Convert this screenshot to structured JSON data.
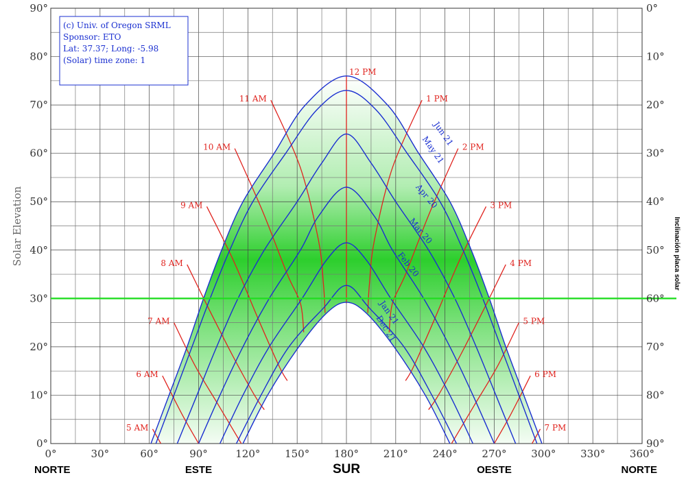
{
  "chart_data": {
    "type": "line",
    "ylabel": "Solar Elevation",
    "y2label": "Inclinación placa solar",
    "xlim": [
      0,
      360
    ],
    "ylim": [
      0,
      90
    ],
    "x_ticks": [
      "0°",
      "30°",
      "60°",
      "90°",
      "120°",
      "150°",
      "180°",
      "210°",
      "240°",
      "270°",
      "300°",
      "330°",
      "360°"
    ],
    "y_ticks": [
      "0°",
      "10°",
      "20°",
      "30°",
      "40°",
      "50°",
      "60°",
      "70°",
      "80°",
      "90°"
    ],
    "y2_ticks": [
      "90°",
      "80°",
      "70°",
      "60°",
      "50°",
      "40°",
      "30°",
      "20°",
      "10°",
      "0°"
    ],
    "directions": [
      {
        "label": "NORTE",
        "x": 0
      },
      {
        "label": "ESTE",
        "x": 90
      },
      {
        "label": "SUR",
        "x": 180
      },
      {
        "label": "OESTE",
        "x": 270
      },
      {
        "label": "NORTE",
        "x": 360
      }
    ],
    "info_box": [
      "(c) Univ. of Oregon SRML",
      "Sponsor: ETO",
      "Lat: 37.37; Long: -5.98",
      "(Solar) time zone: 1"
    ],
    "reference_line": {
      "elevation": 30,
      "color": "#22dd22"
    },
    "highlight_band": {
      "min_elevation": 0,
      "max_elevation": 60,
      "color": "#22cc22"
    },
    "date_curves": [
      {
        "label": "Jun 21",
        "points": [
          [
            61,
            0
          ],
          [
            72,
            10
          ],
          [
            83,
            20
          ],
          [
            93,
            30
          ],
          [
            104,
            40
          ],
          [
            117,
            50
          ],
          [
            136,
            60
          ],
          [
            155,
            70
          ],
          [
            180,
            76
          ],
          [
            205,
            70
          ],
          [
            224,
            60
          ],
          [
            243,
            50
          ],
          [
            256,
            40
          ],
          [
            267,
            30
          ],
          [
            277,
            20
          ],
          [
            288,
            10
          ],
          [
            299,
            0
          ]
        ]
      },
      {
        "label": "May 21",
        "points": [
          [
            64,
            0
          ],
          [
            75,
            10
          ],
          [
            86,
            20
          ],
          [
            97,
            30
          ],
          [
            109,
            40
          ],
          [
            123,
            50
          ],
          [
            143,
            60
          ],
          [
            162,
            69
          ],
          [
            180,
            73
          ],
          [
            198,
            69
          ],
          [
            217,
            60
          ],
          [
            237,
            50
          ],
          [
            251,
            40
          ],
          [
            263,
            30
          ],
          [
            274,
            20
          ],
          [
            285,
            10
          ],
          [
            296,
            0
          ]
        ]
      },
      {
        "label": "Apr 20",
        "points": [
          [
            77,
            0
          ],
          [
            89,
            10
          ],
          [
            101,
            20
          ],
          [
            114,
            30
          ],
          [
            130,
            40
          ],
          [
            150,
            50
          ],
          [
            165,
            58
          ],
          [
            180,
            64
          ],
          [
            195,
            58
          ],
          [
            210,
            50
          ],
          [
            230,
            40
          ],
          [
            246,
            30
          ],
          [
            259,
            20
          ],
          [
            271,
            10
          ],
          [
            283,
            0
          ]
        ]
      },
      {
        "label": "Mar 20",
        "points": [
          [
            90,
            0
          ],
          [
            103,
            10
          ],
          [
            117,
            20
          ],
          [
            133,
            30
          ],
          [
            152,
            40
          ],
          [
            163,
            47
          ],
          [
            180,
            53
          ],
          [
            197,
            47
          ],
          [
            208,
            40
          ],
          [
            227,
            30
          ],
          [
            243,
            20
          ],
          [
            257,
            10
          ],
          [
            270,
            0
          ]
        ]
      },
      {
        "label": "Feb 20",
        "points": [
          [
            103,
            0
          ],
          [
            117,
            10
          ],
          [
            133,
            20
          ],
          [
            153,
            30
          ],
          [
            168,
            38
          ],
          [
            180,
            41.5
          ],
          [
            192,
            38
          ],
          [
            207,
            30
          ],
          [
            227,
            20
          ],
          [
            243,
            10
          ],
          [
            257,
            0
          ]
        ]
      },
      {
        "label": "Jan 21",
        "points": [
          [
            113,
            0
          ],
          [
            128,
            10
          ],
          [
            145,
            20
          ],
          [
            166,
            28
          ],
          [
            180,
            32.7
          ],
          [
            194,
            28
          ],
          [
            215,
            20
          ],
          [
            232,
            10
          ],
          [
            247,
            0
          ]
        ]
      },
      {
        "label": "Dec 21",
        "points": [
          [
            117,
            0
          ],
          [
            132,
            10
          ],
          [
            151,
            20
          ],
          [
            168,
            27
          ],
          [
            180,
            29.2
          ],
          [
            192,
            27
          ],
          [
            209,
            20
          ],
          [
            228,
            10
          ],
          [
            243,
            0
          ]
        ]
      }
    ],
    "hour_curves": [
      {
        "label": "5 AM",
        "points": [
          [
            62,
            3
          ],
          [
            67,
            0
          ]
        ]
      },
      {
        "label": "6 AM",
        "points": [
          [
            68,
            14
          ],
          [
            80,
            6
          ],
          [
            90,
            0
          ]
        ]
      },
      {
        "label": "7 AM",
        "points": [
          [
            75,
            25
          ],
          [
            88,
            16
          ],
          [
            102,
            8
          ],
          [
            116,
            0
          ]
        ]
      },
      {
        "label": "8 AM",
        "points": [
          [
            83,
            37
          ],
          [
            96,
            28
          ],
          [
            111,
            18
          ],
          [
            124,
            10
          ],
          [
            130,
            7
          ]
        ]
      },
      {
        "label": "9 AM",
        "points": [
          [
            95,
            49
          ],
          [
            111,
            38
          ],
          [
            126,
            26
          ],
          [
            139,
            16
          ],
          [
            144,
            13
          ]
        ]
      },
      {
        "label": "10 AM",
        "points": [
          [
            112,
            61
          ],
          [
            129,
            48
          ],
          [
            144,
            35
          ],
          [
            152,
            29
          ],
          [
            154,
            23
          ]
        ]
      },
      {
        "label": "11 AM",
        "points": [
          [
            134,
            71
          ],
          [
            152,
            57
          ],
          [
            163,
            42
          ],
          [
            166,
            33
          ],
          [
            167,
            27
          ]
        ]
      },
      {
        "label": "12 PM",
        "points": [
          [
            180,
            76
          ],
          [
            180,
            29
          ]
        ]
      },
      {
        "label": "1 PM",
        "points": [
          [
            226,
            71
          ],
          [
            208,
            57
          ],
          [
            197,
            42
          ],
          [
            194,
            33
          ],
          [
            193,
            27
          ]
        ]
      },
      {
        "label": "2 PM",
        "points": [
          [
            248,
            61
          ],
          [
            231,
            48
          ],
          [
            216,
            35
          ],
          [
            208,
            29
          ],
          [
            206,
            23
          ]
        ]
      },
      {
        "label": "3 PM",
        "points": [
          [
            265,
            49
          ],
          [
            249,
            38
          ],
          [
            234,
            26
          ],
          [
            221,
            16
          ],
          [
            216,
            13
          ]
        ]
      },
      {
        "label": "4 PM",
        "points": [
          [
            277,
            37
          ],
          [
            264,
            28
          ],
          [
            249,
            18
          ],
          [
            236,
            10
          ],
          [
            230,
            7
          ]
        ]
      },
      {
        "label": "5 PM",
        "points": [
          [
            285,
            25
          ],
          [
            272,
            16
          ],
          [
            258,
            8
          ],
          [
            244,
            0
          ]
        ]
      },
      {
        "label": "6 PM",
        "points": [
          [
            292,
            14
          ],
          [
            280,
            6
          ],
          [
            270,
            0
          ]
        ]
      },
      {
        "label": "7 PM",
        "points": [
          [
            298,
            3
          ],
          [
            293,
            0
          ]
        ]
      }
    ],
    "colors": {
      "date": "#1a2fd0",
      "hour": "#e0231e",
      "grid": "#444444",
      "minor_grid": "#777777"
    }
  }
}
